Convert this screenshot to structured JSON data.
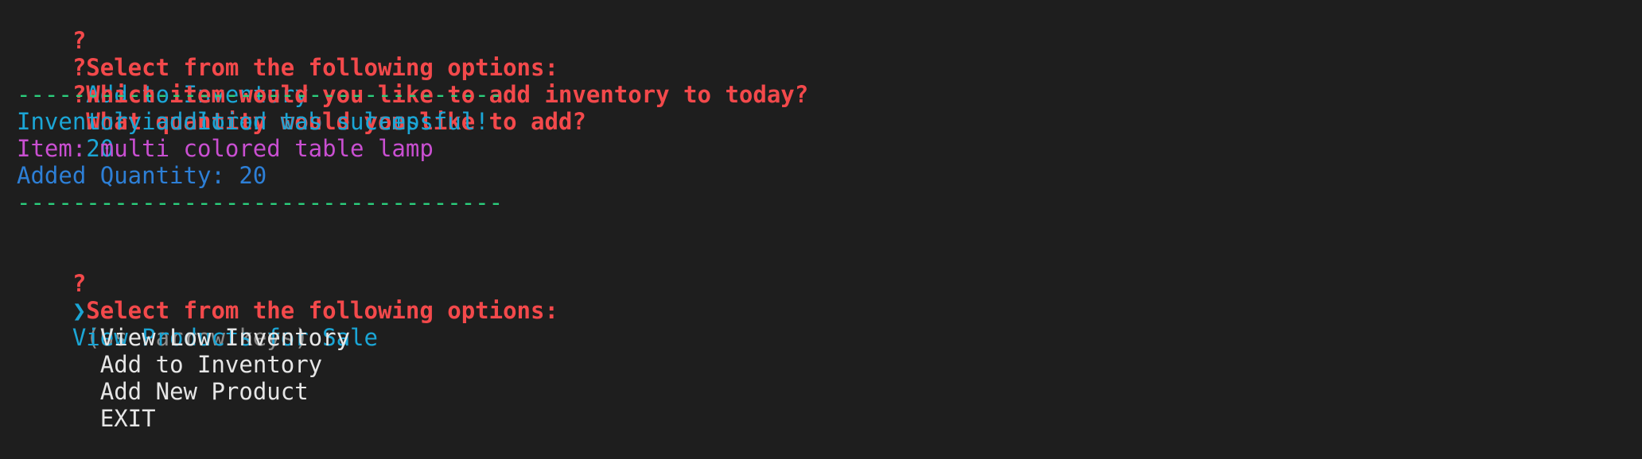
{
  "terminal": {
    "lines": {
      "q1": {
        "marker": "?",
        "prompt": "Select from the following options:",
        "answer": "Add to Inventory"
      },
      "q2": {
        "marker": "?",
        "prompt": "Which item would you like to add inventory to today?",
        "answer": "multi colored table lamp"
      },
      "q3": {
        "marker": "?",
        "prompt": "What quantity would you like to add?",
        "answer": "20"
      },
      "divider1": "-----------------------------------",
      "success_message": "Inventory addition was successful!",
      "item_line": "Item: multi colored table lamp",
      "quantity_line": "Added Quantity: 20",
      "divider2": "-----------------------------------",
      "q4": {
        "marker": "?",
        "prompt": "Select from the following options:",
        "hint": "(Use arrow keys)"
      }
    },
    "menu": {
      "pointer": "❯",
      "options": [
        "View Products for Sale",
        "View Low Inventory",
        "Add to Inventory",
        "Add New Product",
        "EXIT"
      ],
      "selected_index": 0
    },
    "colors": {
      "background": "#1e1e1e",
      "prompt": "#f3494b",
      "answer": "#1ba6d6",
      "divider": "#2bcf7d",
      "item": "#c94fd1",
      "quantity": "#2d7fd6",
      "hint": "#8a8a8a",
      "default_text": "#e6e6e6"
    }
  }
}
